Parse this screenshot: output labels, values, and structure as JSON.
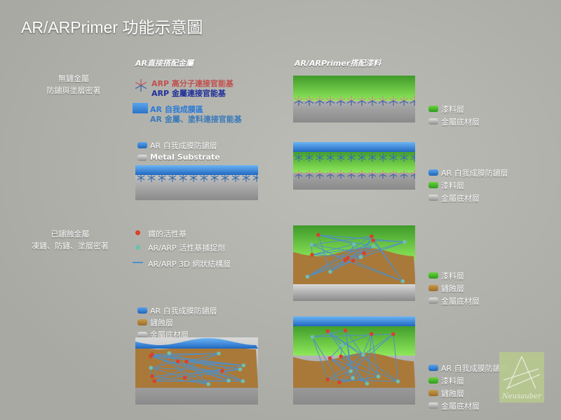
{
  "title": "AR/ARPrimer 功能示意圖",
  "columns": {
    "left": "AR直接搭配金屬",
    "right": "AR/ARPrimer搭配漆料"
  },
  "categories": [
    {
      "line1": "無鏽金屬",
      "line2": "防鏽與塗層密著"
    },
    {
      "line1": "已鏽蝕金屬",
      "line2": "凍鏽、防鏽、塗層密著"
    }
  ],
  "legend_top": {
    "arp_polymer": "ARP 高分子連接官能基",
    "arp_metal": "ARP 金屬連接官能基",
    "ar_film": "AR 自我成膜區",
    "ar_metal_paint": "AR 金屬、塗料連接官能基"
  },
  "legend_a": [
    "AR 自我成膜防鏽層",
    "Metal Substrate"
  ],
  "legend_b": [
    "漆料層",
    "金屬底材層"
  ],
  "legend_c": [
    "AR 自我成膜防鏽層",
    "漆料層",
    "金屬底材層"
  ],
  "legend_d": [
    "鐵的活性基",
    "AR/ARP 活性基捕捉劑",
    "AR/ARP 3D 網狀結構層"
  ],
  "legend_e": [
    "漆料層",
    "鏽蝕層",
    "金屬底材層"
  ],
  "legend_f": [
    "AR 自我成膜防鏽層",
    "鏽蝕層",
    "金屬底材層"
  ],
  "legend_g": [
    "AR 自我成膜防鏽層",
    "漆料層",
    "鏽蝕層",
    "金屬底材層"
  ],
  "logo_text": "Neusauber",
  "colors": {
    "ar_film": "#2f80d8",
    "paint": "#55c232",
    "rust": "#a9793a",
    "metal": "#a0a0a0",
    "iron_active": "#d9412a",
    "catcher": "#6fbfae",
    "network": "#4f8fc8",
    "arp_polymer": "#c0504d",
    "arp_metal": "#1f2f9a"
  }
}
